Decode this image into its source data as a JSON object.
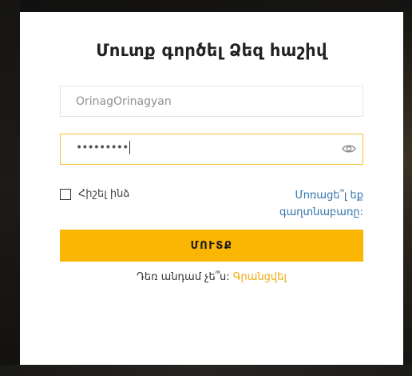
{
  "login": {
    "title": "Մուտք գործել Ձեզ հաշիվ",
    "username_value": "OrinagOrinagyan",
    "password_mask": "•••••••••",
    "remember_label": "Հիշել ինձ",
    "forgot_label": "Մոռացե՞լ եք գաղտնաբառը:",
    "submit_label": "ՄՈՒՏՔ",
    "no_account_text": "Դեռ անդամ չե՞ս:",
    "signup_label": "Գրանցվել"
  },
  "icons": {
    "show_password": "eye-icon",
    "remember_checkbox": "checkbox-unchecked"
  },
  "colors": {
    "accent": "#fbb503",
    "focus_border": "#f1c232",
    "link": "#2f72ab",
    "signup_link": "#f0a80c"
  }
}
